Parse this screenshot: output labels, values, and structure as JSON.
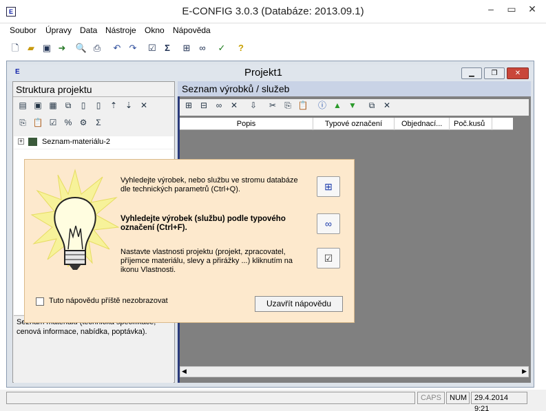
{
  "app": {
    "title": "E-CONFIG 3.0.3  (Databáze: 2013.09.1)",
    "icon": "app-icon"
  },
  "window_controls": {
    "minimize": "‒",
    "restore": "▭",
    "close": "✕"
  },
  "menu": [
    "Soubor",
    "Úpravy",
    "Data",
    "Nástroje",
    "Okno",
    "Nápověda"
  ],
  "toolbar_icons": [
    "new-document-icon",
    "open-folder-icon",
    "save-icon",
    "export-icon",
    "print-preview-icon",
    "print-icon",
    "undo-icon",
    "redo-icon",
    "properties-icon",
    "sum-icon",
    "tree-search-icon",
    "binoculars-icon",
    "checklist-icon",
    "help-icon"
  ],
  "child": {
    "title": "Projekt1",
    "minimize": "▁",
    "restore": "❐",
    "close": "✕"
  },
  "left": {
    "header": "Struktura projektu",
    "tree_item": "Seznam-materiálu-2",
    "description": "Seznam materiálů (technická specifikace, cenová informace, nabídka, poptávka)."
  },
  "right": {
    "header": "Seznam výrobků / služeb",
    "columns": [
      "Popis",
      "Typové označení",
      "Objednací...",
      "Poč.kusů"
    ]
  },
  "tip": {
    "text1": "Vyhledejte výrobek, nebo službu ve stromu databáze dle technických parametrů (Ctrl+Q).",
    "text2": "Vyhledejte výrobek (službu) podle typového označení (Ctrl+F).",
    "text3": "Nastavte vlastnosti projektu (projekt, zpracovatel, příjemce materiálu, slevy a přirážky ...) kliknutím na ikonu Vlastnosti.",
    "checkbox_label": "Tuto nápovědu příště nezobrazovat",
    "close_label": "Uzavřít nápovědu"
  },
  "status": {
    "caps": "CAPS",
    "num": "NUM",
    "datetime": "29.4.2014 9:21"
  }
}
